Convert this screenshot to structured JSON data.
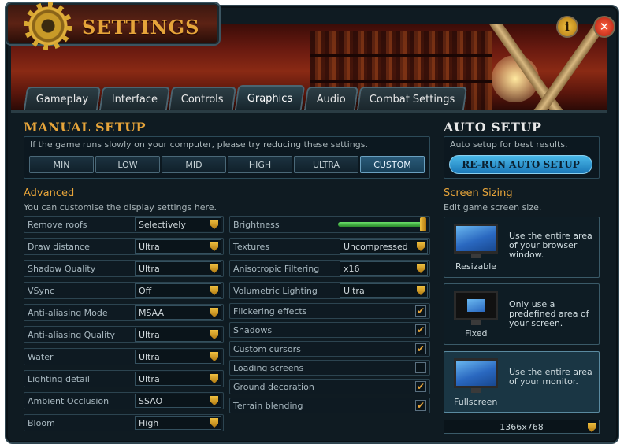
{
  "window": {
    "title": "SETTINGS",
    "info_label": "i",
    "close_label": "✕",
    "colors": {
      "accent": "#e6a43a",
      "panel": "#0f1b22",
      "border": "#2f4550",
      "button_blue": "#1a78b8"
    }
  },
  "tabs": [
    {
      "label": "Gameplay",
      "active": false
    },
    {
      "label": "Interface",
      "active": false
    },
    {
      "label": "Controls",
      "active": false
    },
    {
      "label": "Graphics",
      "active": true
    },
    {
      "label": "Audio",
      "active": false
    },
    {
      "label": "Combat Settings",
      "active": false
    }
  ],
  "manual": {
    "title": "MANUAL SETUP",
    "hint": "If the game runs slowly on your computer, please try reducing these settings.",
    "presets": [
      {
        "label": "MIN",
        "active": false
      },
      {
        "label": "LOW",
        "active": false
      },
      {
        "label": "MID",
        "active": false
      },
      {
        "label": "HIGH",
        "active": false
      },
      {
        "label": "ULTRA",
        "active": false
      },
      {
        "label": "CUSTOM",
        "active": true
      }
    ]
  },
  "auto": {
    "title": "AUTO SETUP",
    "hint": "Auto setup for best results.",
    "button_label": "RE-RUN AUTO SETUP"
  },
  "advanced": {
    "title": "Advanced",
    "hint": "You can customise the display settings here.",
    "left_rows": [
      {
        "label": "Remove roofs",
        "value": "Selectively"
      },
      {
        "label": "Draw distance",
        "value": "Ultra"
      },
      {
        "label": "Shadow Quality",
        "value": "Ultra"
      },
      {
        "label": "VSync",
        "value": "Off"
      },
      {
        "label": "Anti-aliasing Mode",
        "value": "MSAA"
      },
      {
        "label": "Anti-aliasing Quality",
        "value": "Ultra"
      },
      {
        "label": "Water",
        "value": "Ultra"
      },
      {
        "label": "Lighting detail",
        "value": "Ultra"
      },
      {
        "label": "Ambient Occlusion",
        "value": "SSAO"
      },
      {
        "label": "Bloom",
        "value": "High"
      }
    ],
    "brightness": {
      "label": "Brightness",
      "level": 1.0
    },
    "right_dropdowns": [
      {
        "label": "Textures",
        "value": "Uncompressed"
      },
      {
        "label": "Anisotropic Filtering",
        "value": "x16"
      },
      {
        "label": "Volumetric Lighting",
        "value": "Ultra"
      }
    ],
    "checkboxes": [
      {
        "label": "Flickering effects",
        "checked": true
      },
      {
        "label": "Shadows",
        "checked": true
      },
      {
        "label": "Custom cursors",
        "checked": true
      },
      {
        "label": "Loading screens",
        "checked": false
      },
      {
        "label": "Ground decoration",
        "checked": true
      },
      {
        "label": "Terrain blending",
        "checked": true
      }
    ]
  },
  "screen": {
    "title": "Screen Sizing",
    "hint": "Edit game screen size.",
    "modes": [
      {
        "label": "Resizable",
        "text": "Use the entire area of your browser window.",
        "active": false,
        "icon": "resizable-monitor-icon"
      },
      {
        "label": "Fixed",
        "text": "Only use a predefined area of your screen.",
        "active": false,
        "icon": "fixed-monitor-icon"
      },
      {
        "label": "Fullscreen",
        "text": "Use the entire area of your monitor.",
        "active": true,
        "icon": "fullscreen-monitor-icon"
      }
    ],
    "resolution": "1366x768"
  },
  "check_glyph": "✔"
}
